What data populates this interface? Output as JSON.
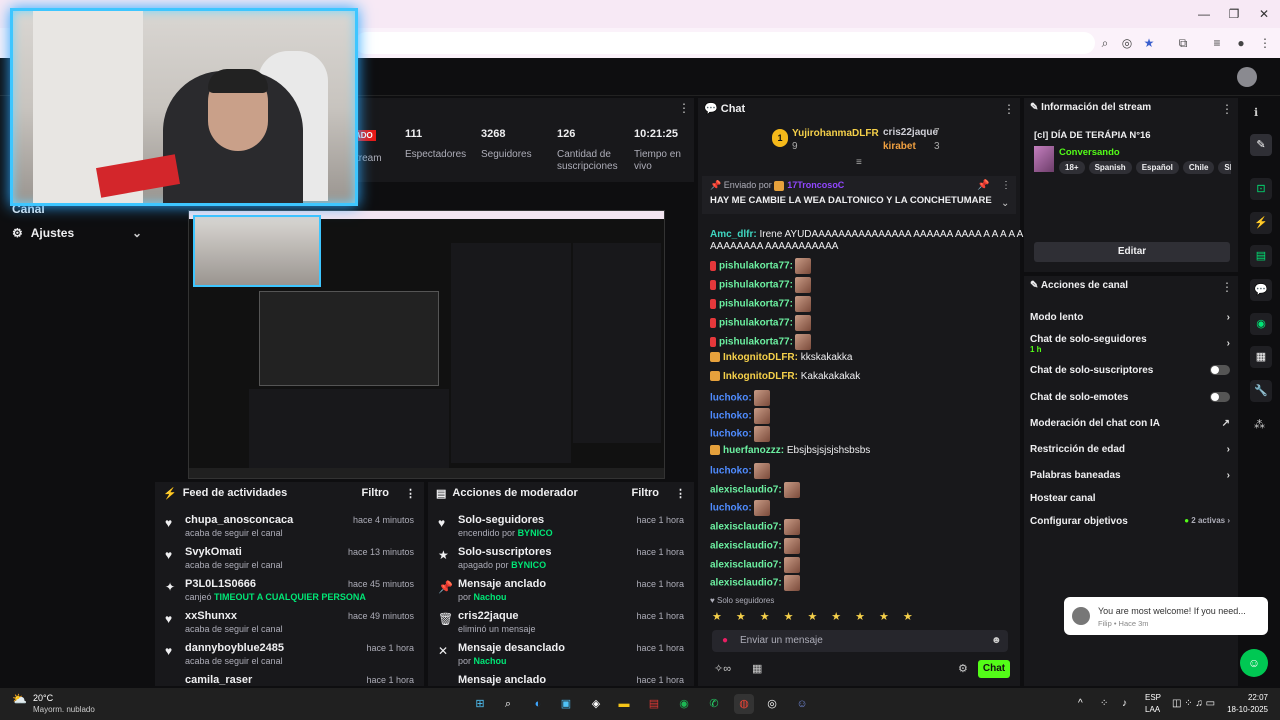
{
  "chat": {
    "title": "Chat",
    "leaders": {
      "first": "YujirohanmaDLFR",
      "first_score": "9",
      "second": "cris22jaque",
      "second_score": "7",
      "third": "kirabet",
      "third_score": "3"
    },
    "pinned": {
      "by_label": "Enviado por",
      "by_user": "17TroncosoC",
      "message": "HAY ME CAMBIE LA WEA DALTONICO Y LA CONCHETUMARE"
    },
    "messages": [
      {
        "user": "Amc_dlfr:",
        "text": "Irene AYUDAAAAAAAAAAAAAAA AAAAAA AAAA A A A A A A A"
      },
      {
        "user": "",
        "text": "AAAAAAAA AAAAAAAAAAA"
      },
      {
        "user": "pishulakorta77:",
        "text": ""
      },
      {
        "user": "pishulakorta77:",
        "text": ""
      },
      {
        "user": "pishulakorta77:",
        "text": ""
      },
      {
        "user": "pishulakorta77:",
        "text": ""
      },
      {
        "user": "pishulakorta77:",
        "text": ""
      },
      {
        "user": "InkognitoDLFR:",
        "text": "kkskakakka"
      },
      {
        "user": "InkognitoDLFR:",
        "text": "Kakakakakak"
      },
      {
        "user": "luchoko:",
        "text": ""
      },
      {
        "user": "luchoko:",
        "text": ""
      },
      {
        "user": "luchoko:",
        "text": ""
      },
      {
        "user": "huerfanozzz:",
        "text": "Ebsjbsjsjsjshsbsbs"
      },
      {
        "user": "luchoko:",
        "text": ""
      },
      {
        "user": "alexisclaudio7:",
        "text": ""
      },
      {
        "user": "luchoko:",
        "text": ""
      },
      {
        "user": "alexisclaudio7:",
        "text": ""
      },
      {
        "user": "alexisclaudio7:",
        "text": ""
      },
      {
        "user": "alexisclaudio7:",
        "text": ""
      },
      {
        "user": "alexisclaudio7:",
        "text": ""
      }
    ],
    "mode": "Solo seguidores",
    "input_placeholder": "Enviar un mensaje",
    "send_label": "Chat"
  },
  "stats": [
    {
      "num": "111",
      "label": "Espectadores"
    },
    {
      "num": "3268",
      "label": "Seguidores"
    },
    {
      "num": "126",
      "label": "Cantidad de suscripciones"
    },
    {
      "num": "10:21:25",
      "label": "Tiempo en vivo"
    }
  ],
  "live_badge": "ADO",
  "live_sub": "tream",
  "sidebar": {
    "canal": "Canal",
    "ajustes": "Ajustes"
  },
  "feed": {
    "title": "Feed de actividades",
    "filter": "Filtro",
    "items": [
      {
        "name": "chupa_anosconcaca",
        "sub": "acaba de seguir el canal",
        "time": "hace 4 minutos",
        "highlight": ""
      },
      {
        "name": "SvykOmati",
        "sub": "acaba de seguir el canal",
        "time": "hace 13 minutos",
        "highlight": ""
      },
      {
        "name": "P3L0L1S0666",
        "sub": "canjeó",
        "time": "hace 45 minutos",
        "highlight": "TIMEOUT A CUALQUIER PERSONA"
      },
      {
        "name": "xxShunxx",
        "sub": "acaba de seguir el canal",
        "time": "hace 49 minutos",
        "highlight": ""
      },
      {
        "name": "dannyboyblue2485",
        "sub": "acaba de seguir el canal",
        "time": "hace 1 hora",
        "highlight": ""
      },
      {
        "name": "camila_raser",
        "sub": "",
        "time": "hace 1 hora",
        "highlight": ""
      }
    ]
  },
  "modactions": {
    "title": "Acciones de moderador",
    "filter": "Filtro",
    "items": [
      {
        "name": "Solo-seguidores",
        "sub": "encendido por",
        "who": "BYNICO",
        "time": "hace 1 hora"
      },
      {
        "name": "Solo-suscriptores",
        "sub": "apagado por",
        "who": "BYNICO",
        "time": "hace 1 hora"
      },
      {
        "name": "Mensaje anclado",
        "sub": "por",
        "who": "Nachou",
        "time": "hace 1 hora"
      },
      {
        "name": "cris22jaque",
        "sub": "eliminó un mensaje",
        "who": "",
        "time": "hace 1 hora"
      },
      {
        "name": "Mensaje desanclado",
        "sub": "por",
        "who": "Nachou",
        "time": "hace 1 hora"
      },
      {
        "name": "Mensaje anclado",
        "sub": "",
        "who": "",
        "time": "hace 1 hora"
      }
    ]
  },
  "info": {
    "title": "Información del stream",
    "stream_title": "[cl] DÍA DE TERÁPIA N°16",
    "category": "Conversando",
    "tags": [
      "18+",
      "Spanish",
      "Español",
      "Chile",
      "Shoote"
    ],
    "edit_label": "Editar"
  },
  "channel_actions": {
    "title": "Acciones de canal",
    "items": [
      {
        "label": "Modo lento",
        "sub": ""
      },
      {
        "label": "Chat de solo-seguidores",
        "sub": "1 h"
      },
      {
        "label": "Chat de solo-suscriptores",
        "sub": ""
      },
      {
        "label": "Chat de solo-emotes",
        "sub": ""
      },
      {
        "label": "Moderación del chat con IA",
        "sub": ""
      },
      {
        "label": "Restricción de edad",
        "sub": ""
      },
      {
        "label": "Palabras baneadas",
        "sub": ""
      },
      {
        "label": "Hostear canal",
        "sub": ""
      },
      {
        "label": "Configurar objetivos",
        "sub": "2 activas"
      }
    ]
  },
  "toast": {
    "text": "You are most welcome! If you need...",
    "meta": "Filip • Hace 3m"
  },
  "weather": {
    "temp": "20°C",
    "desc": "Mayorm. nublado"
  },
  "tray": {
    "lang": "ESP",
    "region": "LAA",
    "time": "22:07",
    "date": "18-10-2025"
  }
}
